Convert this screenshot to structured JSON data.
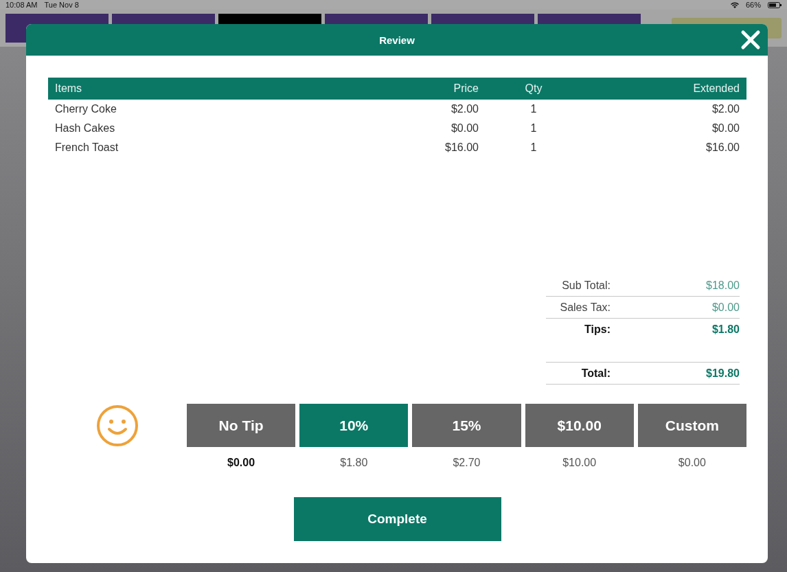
{
  "status_bar": {
    "time": "10:08 AM",
    "date": "Tue Nov 8",
    "battery": "66%"
  },
  "background_tabs": [
    {
      "selected": false
    },
    {
      "selected": false
    },
    {
      "selected": true
    },
    {
      "selected": false
    },
    {
      "selected": false
    },
    {
      "selected": false
    }
  ],
  "dialog": {
    "title": "Review",
    "table": {
      "columns": [
        "Items",
        "Price",
        "Qty",
        "Extended"
      ],
      "rows": [
        [
          "Cherry Coke",
          "$2.00",
          "1",
          "$2.00"
        ],
        [
          "Hash Cakes",
          "$0.00",
          "1",
          "$0.00"
        ],
        [
          "French Toast",
          "$16.00",
          "1",
          "$16.00"
        ]
      ]
    },
    "totals": [
      {
        "label": "Sub Total:",
        "value": "$18.00",
        "bold": false
      },
      {
        "label": "Sales Tax:",
        "value": "$0.00",
        "bold": false
      },
      {
        "label": "Tips:",
        "value": "$1.80",
        "bold": true
      },
      {
        "label": "Total:",
        "value": "$19.80",
        "bold": true
      }
    ],
    "tips": [
      {
        "label": "No Tip",
        "amount": "$0.00",
        "selected": false,
        "bold": true
      },
      {
        "label": "10%",
        "amount": "$1.80",
        "selected": true,
        "bold": false
      },
      {
        "label": "15%",
        "amount": "$2.70",
        "selected": false,
        "bold": false
      },
      {
        "label": "$10.00",
        "amount": "$10.00",
        "selected": false,
        "bold": false
      },
      {
        "label": "Custom",
        "amount": "$0.00",
        "selected": false,
        "bold": false
      }
    ],
    "complete_button": "Complete"
  }
}
